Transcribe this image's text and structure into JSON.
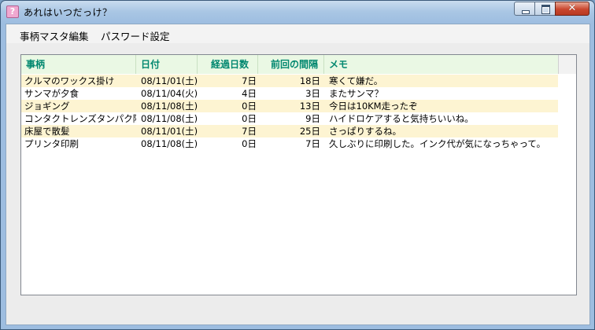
{
  "window": {
    "title": "あれはいつだっけ？",
    "close_glyph": "✕"
  },
  "menu": [
    "事柄マスタ編集",
    "パスワード設定"
  ],
  "table": {
    "headers": [
      "事柄",
      "日付",
      "経過日数",
      "前回の間隔",
      "メモ"
    ],
    "rows": [
      [
        "クルマのワックス掛け",
        "08/11/01(土)",
        "7日",
        "18日",
        "寒くて嫌だ。"
      ],
      [
        "サンマが夕食",
        "08/11/04(火)",
        "4日",
        "3日",
        "またサンマ？"
      ],
      [
        "ジョギング",
        "08/11/08(土)",
        "0日",
        "13日",
        "今日は10KM走ったぞ"
      ],
      [
        "コンタクトレンズタンパク除",
        "08/11/08(土)",
        "0日",
        "9日",
        "ハイドロケアすると気持ちいいね。"
      ],
      [
        "床屋で散髪",
        "08/11/01(土)",
        "7日",
        "25日",
        "さっぱりするね。"
      ],
      [
        "プリンタ印刷",
        "08/11/08(土)",
        "0日",
        "7日",
        "久しぶりに印刷した。インク代が気になっちゃって。"
      ]
    ]
  },
  "colors": {
    "header_text": "#00876f",
    "header_bg": "#eaf8e4",
    "alt_row_bg": "#fdf4d2"
  }
}
